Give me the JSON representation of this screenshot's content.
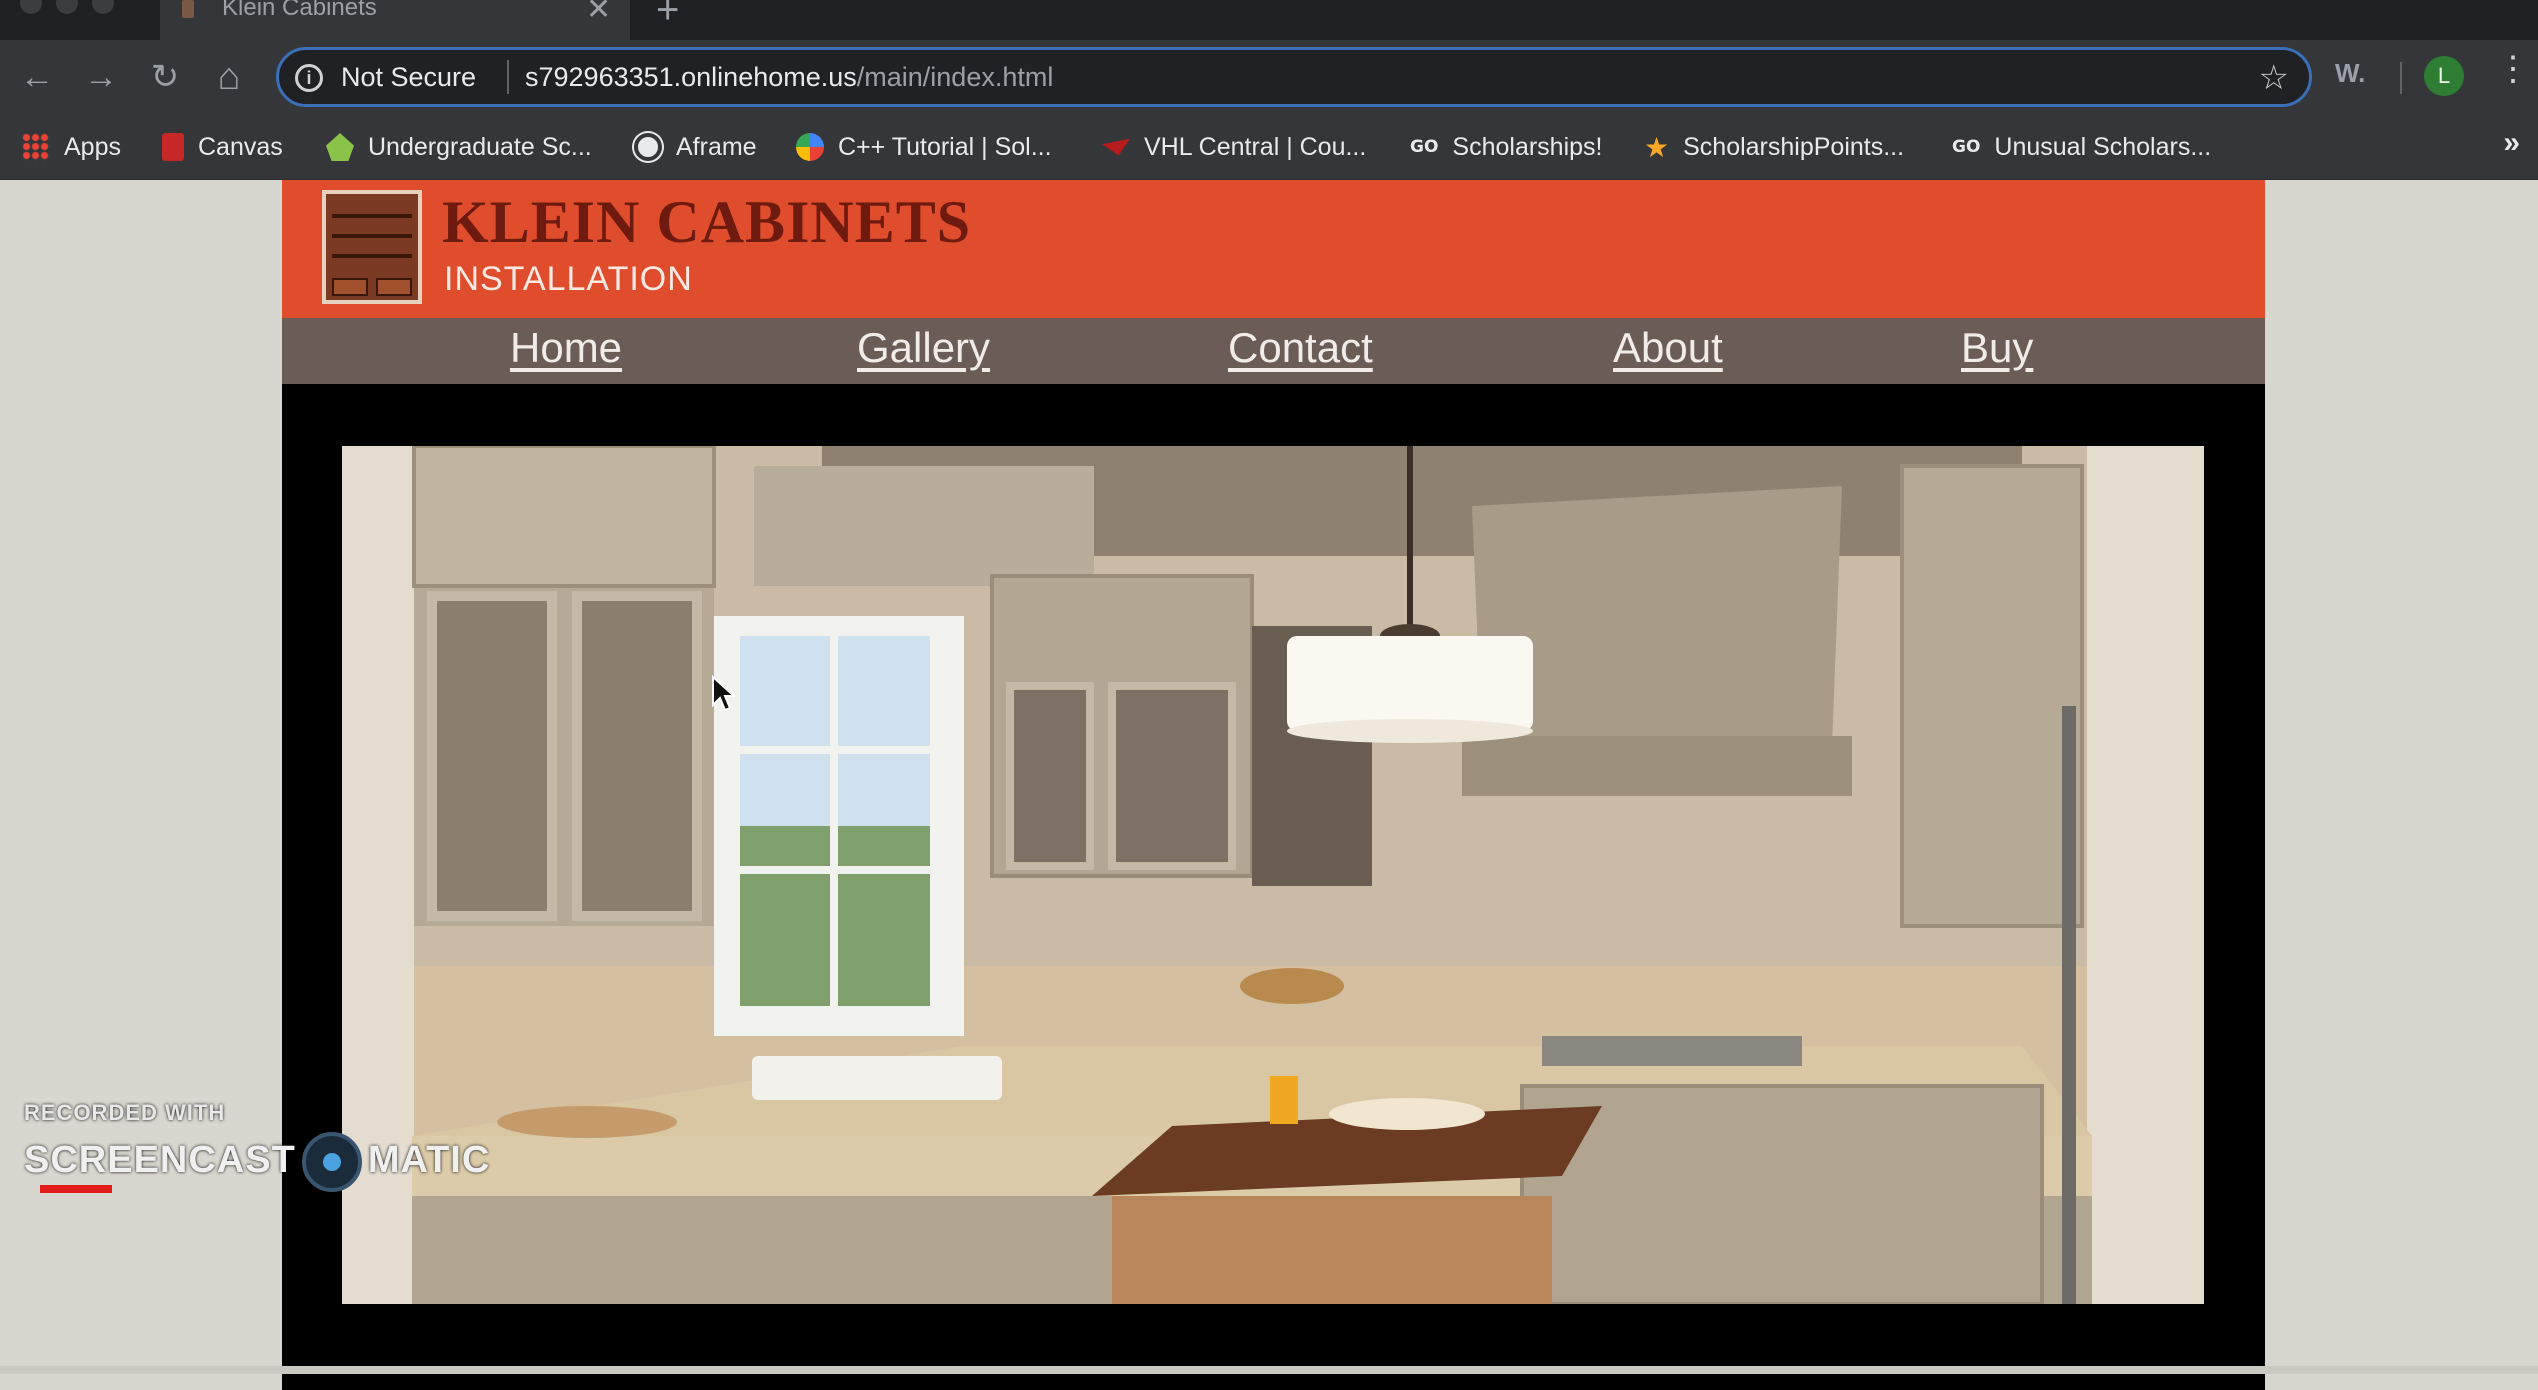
{
  "browser": {
    "tab": {
      "title": "Klein Cabinets",
      "close": "✕"
    },
    "new_tab": "+",
    "toolbar": {
      "back": "←",
      "forward": "→",
      "reload": "↻",
      "home": "⌂",
      "security_label": "Not Secure",
      "url_host": "s792963351.onlinehome.us",
      "url_path": "/main/index.html",
      "bookmark_star": "☆",
      "extension_label": "W.",
      "profile_initial": "L",
      "menu": "⋮"
    },
    "bookmarks": [
      {
        "label": "Apps",
        "icon": "apps-grid-icon"
      },
      {
        "label": "Canvas",
        "icon": "canvas-icon"
      },
      {
        "label": "Undergraduate Sc...",
        "icon": "graduation-icon"
      },
      {
        "label": "Aframe",
        "icon": "globe-icon"
      },
      {
        "label": "C++ Tutorial | Sol...",
        "icon": "chrome-color-icon"
      },
      {
        "label": "VHL Central | Cou...",
        "icon": "vhl-icon"
      },
      {
        "label": "Scholarships!",
        "icon": "go-icon"
      },
      {
        "label": "ScholarshipPoints...",
        "icon": "star-icon"
      },
      {
        "label": "Unusual Scholars...",
        "icon": "go-icon"
      }
    ],
    "bookmarks_more": "»"
  },
  "site": {
    "title": "KLEIN CABINETS",
    "subtitle": "INSTALLATION",
    "nav": [
      "Home",
      "Gallery",
      "Contact",
      "About",
      "Buy"
    ]
  },
  "watermark": {
    "line1": "RECORDED WITH",
    "left": "SCREENCAST",
    "right": "MATIC"
  }
}
